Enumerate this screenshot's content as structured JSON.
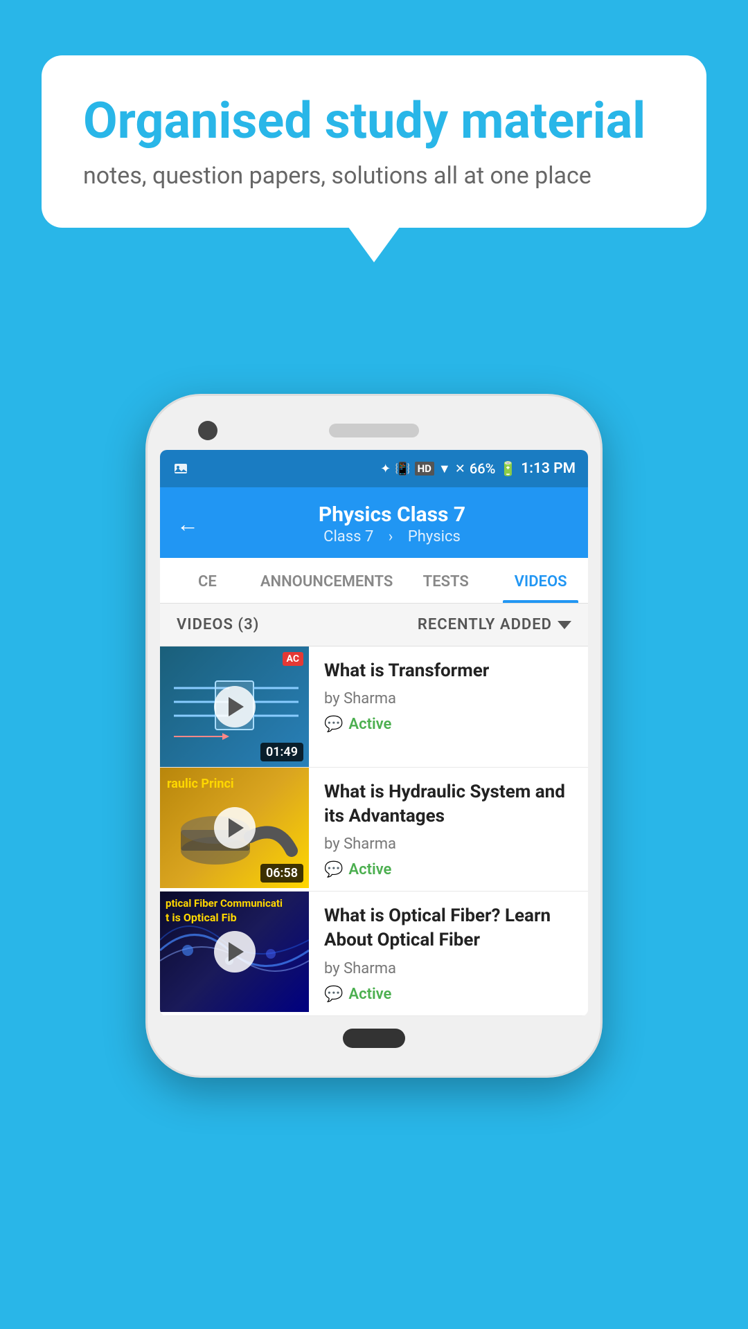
{
  "background_color": "#29b6e8",
  "speech_bubble": {
    "heading": "Organised study material",
    "subtext": "notes, question papers, solutions all at one place"
  },
  "status_bar": {
    "time": "1:13 PM",
    "battery": "66%",
    "signal_icons": "bluetooth vibrate HD wifi signal x"
  },
  "app_header": {
    "title": "Physics Class 7",
    "subtitle_class": "Class 7",
    "subtitle_subject": "Physics",
    "back_label": "←"
  },
  "tabs": [
    {
      "id": "ce",
      "label": "CE",
      "active": false
    },
    {
      "id": "announcements",
      "label": "ANNOUNCEMENTS",
      "active": false
    },
    {
      "id": "tests",
      "label": "TESTS",
      "active": false
    },
    {
      "id": "videos",
      "label": "VIDEOS",
      "active": true
    }
  ],
  "filter_bar": {
    "label": "VIDEOS (3)",
    "sort_label": "RECENTLY ADDED"
  },
  "videos": [
    {
      "id": 1,
      "title": "What is  Transformer",
      "author": "by Sharma",
      "status": "Active",
      "duration": "01:49",
      "thumb_type": "transformer",
      "thumb_badge": "AC"
    },
    {
      "id": 2,
      "title": "What is Hydraulic System and its Advantages",
      "author": "by Sharma",
      "status": "Active",
      "duration": "06:58",
      "thumb_type": "hydraulic",
      "thumb_text_line1": "raulic Princi"
    },
    {
      "id": 3,
      "title": "What is Optical Fiber? Learn About Optical Fiber",
      "author": "by Sharma",
      "status": "Active",
      "duration": "",
      "thumb_type": "optical",
      "thumb_text_line1": "ptical Fiber Communicati",
      "thumb_text_line2": "t is Optical Fib"
    }
  ],
  "icons": {
    "back": "←",
    "play": "▶",
    "chevron_down": "▾",
    "chat": "💬",
    "bluetooth": "⚡",
    "wifi": "▼"
  }
}
